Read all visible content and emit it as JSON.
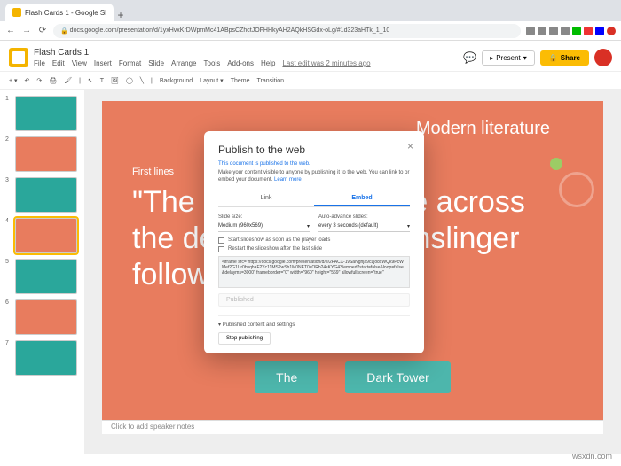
{
  "browser": {
    "tab_title": "Flash Cards 1 - Google Sl",
    "url": "docs.google.com/presentation/d/1yxHvxKrDWpmMc41ABpsCZhctJOFHHkyAH2AQkHSGdx-oLg/#1d323aHTk_1_10"
  },
  "app": {
    "doc_title": "Flash Cards 1",
    "menus": [
      "File",
      "Edit",
      "View",
      "Insert",
      "Format",
      "Slide",
      "Arrange",
      "Tools",
      "Add-ons",
      "Help"
    ],
    "last_edit": "Last edit was 2 minutes ago",
    "present": "Present",
    "share": "Share"
  },
  "toolbar": {
    "background": "Background",
    "layout": "Layout",
    "theme": "Theme",
    "transition": "Transition"
  },
  "slide": {
    "title": "Modern literature",
    "subtitle": "First lines",
    "quote_l1": "\"The m",
    "quote_l2": "the des",
    "quote_l3": "followe",
    "quote_r1": "de across",
    "quote_r2": "unslinger",
    "btn1": "The",
    "btn2": "Dark Tower"
  },
  "dialog": {
    "title": "Publish to the web",
    "status": "This document is published to the web.",
    "desc": "Make your content visible to anyone by publishing it to the web. You can link to or embed your document. ",
    "learn": "Learn more",
    "tab_link": "Link",
    "tab_embed": "Embed",
    "slide_size_label": "Slide size:",
    "slide_size_value": "Medium (960x569)",
    "auto_label": "Auto-advance slides:",
    "auto_value": "every 3 seconds (default)",
    "check1": "Start slideshow as soon as the player loads",
    "check2": "Restart the slideshow after the last slide",
    "embed_code": "<iframe src=\"https://docs.google.com/presentation/d/e/2PACX-1vSaNghja9cLjo8xWQk9PcWMef2G1Ur0bvqhaF2Yc11MS2wSb1M0NET0xORb24sKYG43/embed?start=false&loop=false&delayms=3000\" frameborder=\"0\" width=\"960\" height=\"569\" allowfullscreen=\"true\"",
    "published_btn": "Published",
    "section": "Published content and settings",
    "stop": "Stop publishing"
  },
  "notes": "Click to add speaker notes",
  "watermark": "wsxdn.com"
}
